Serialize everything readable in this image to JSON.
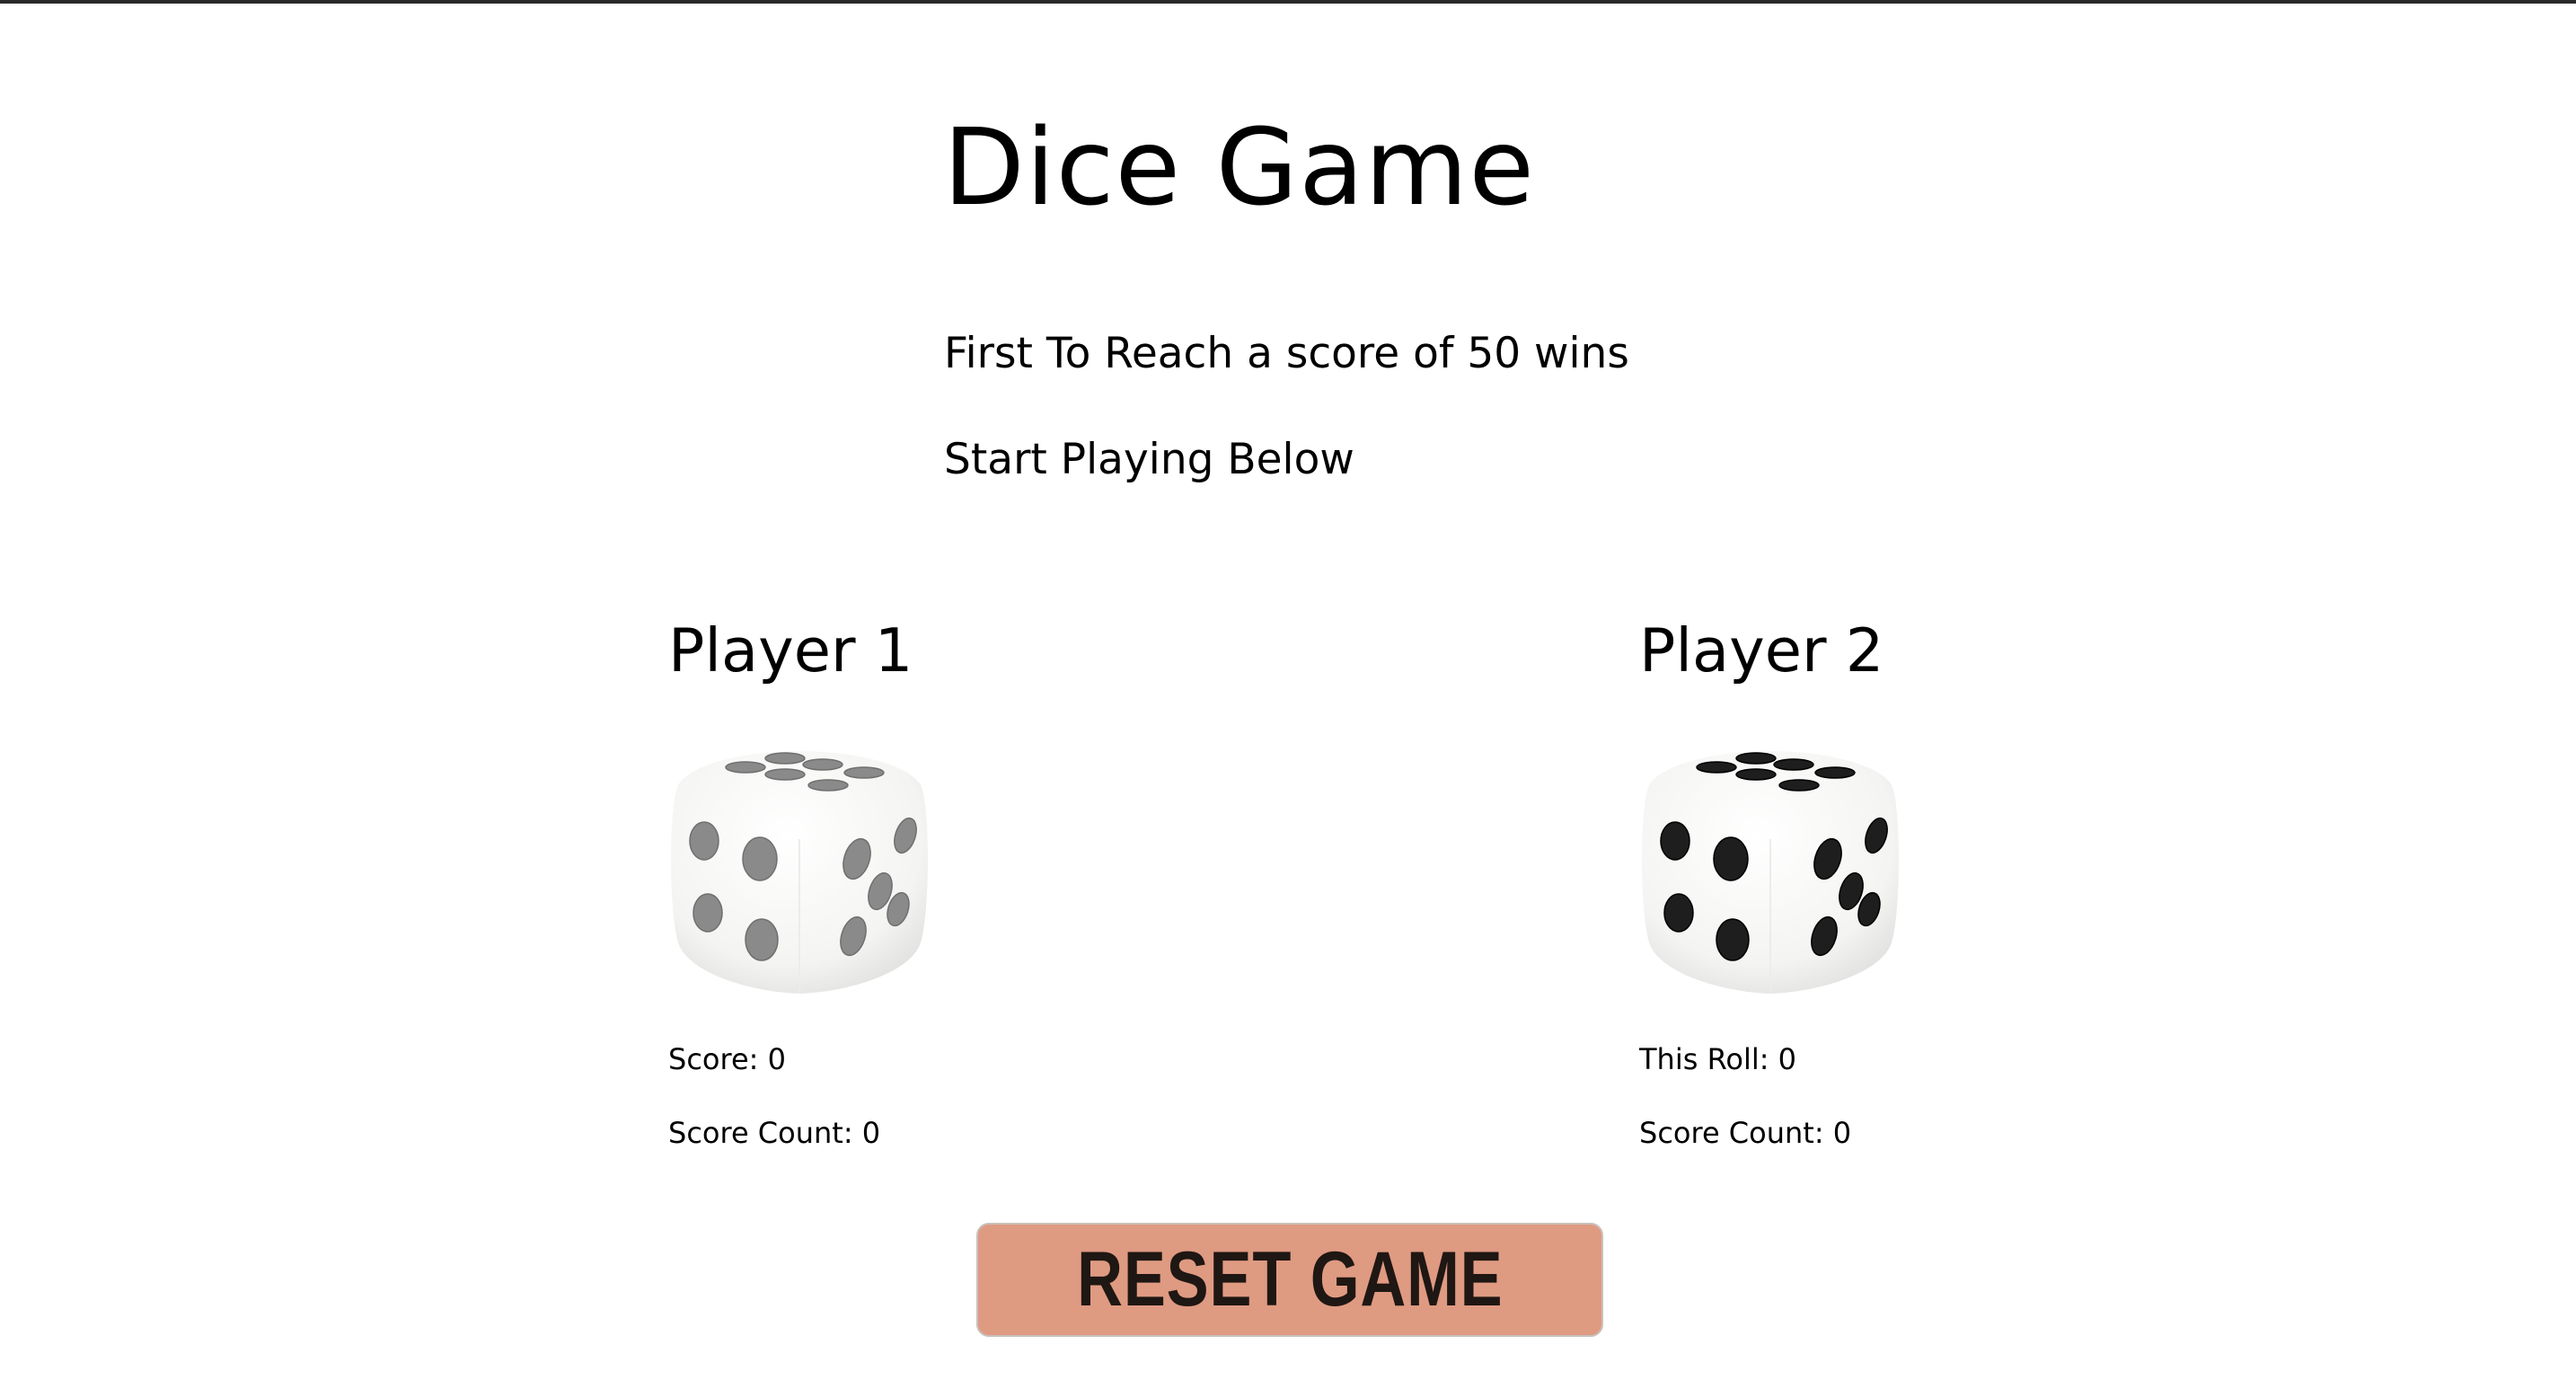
{
  "page": {
    "title": "Dice Game",
    "rules_text": "First To Reach a score of 50 wins",
    "prompt_text": "Start Playing Below"
  },
  "players": [
    {
      "name": "Player 1",
      "stat1": "Score: 0",
      "stat2": "Score Count: 0",
      "dice_value": 6,
      "dice_style": "faded"
    },
    {
      "name": "Player 2",
      "stat1": "This Roll: 0",
      "stat2": "Score Count: 0",
      "dice_value": 6,
      "dice_style": "active"
    }
  ],
  "reset_button": {
    "label": "RESET GAME",
    "color": "#df9a82"
  },
  "colors": {
    "pip_faded": "#8a8a8a",
    "pip_active": "#1e1e1e",
    "top_border": "#2a2a2a"
  }
}
